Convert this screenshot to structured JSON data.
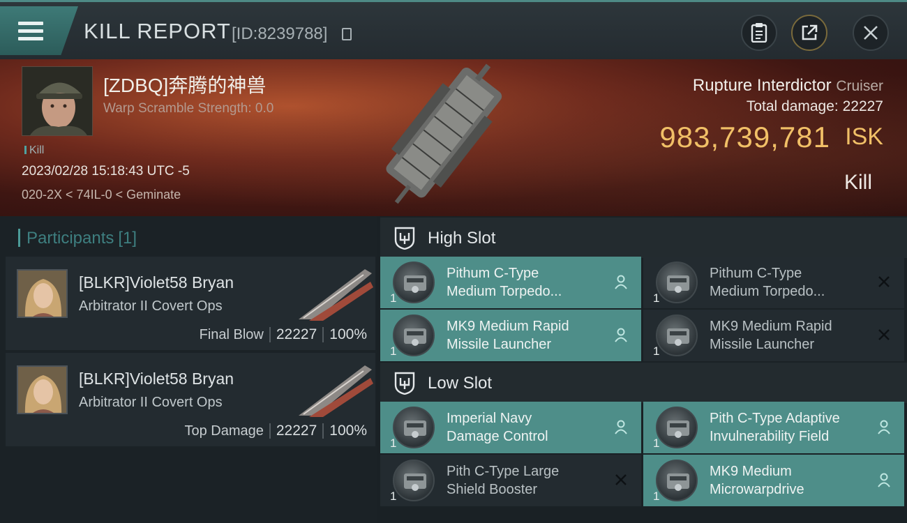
{
  "header": {
    "title": "KILL REPORT",
    "report_id": "[ID:8239788]",
    "icons": [
      "menu-icon",
      "copy-icon",
      "clipboard-icon",
      "share-icon",
      "close-icon"
    ]
  },
  "victim": {
    "name": "[ZDBQ]奔腾的神兽",
    "subtitle": "Warp Scramble Strength: 0.0",
    "tag": "Kill",
    "datetime": "2023/02/28 15:18:43 UTC -5",
    "location": "020-2X < 74IL-0 < Geminate"
  },
  "summary": {
    "ship": "Rupture Interdictor",
    "ship_class": "Cruiser",
    "damage_label": "Total damage:",
    "damage_value": "22227",
    "isk_value": "983,739,781",
    "isk_unit": "ISK",
    "result": "Kill"
  },
  "participants": {
    "title": "Participants",
    "count": "[1]",
    "cards": [
      {
        "name": "[BLKR]Violet58 Bryan",
        "ship": "Arbitrator II Covert Ops",
        "role": "Final Blow",
        "damage": "22227",
        "percent": "100%"
      },
      {
        "name": "[BLKR]Violet58 Bryan",
        "ship": "Arbitrator II Covert Ops",
        "role": "Top Damage",
        "damage": "22227",
        "percent": "100%"
      }
    ]
  },
  "slots": {
    "high": {
      "label": "High Slot",
      "modules": [
        {
          "line1": "Pithum C-Type",
          "line2": "Medium Torpedo...",
          "qty": "1",
          "status": "dropped"
        },
        {
          "line1": "Pithum C-Type",
          "line2": "Medium Torpedo...",
          "qty": "1",
          "status": "destroyed"
        },
        {
          "line1": "MK9 Medium Rapid",
          "line2": "Missile Launcher",
          "qty": "1",
          "status": "dropped"
        },
        {
          "line1": "MK9 Medium Rapid",
          "line2": "Missile Launcher",
          "qty": "1",
          "status": "destroyed"
        }
      ]
    },
    "low": {
      "label": "Low Slot",
      "modules": [
        {
          "line1": "Imperial Navy",
          "line2": "Damage Control",
          "qty": "1",
          "status": "dropped"
        },
        {
          "line1": "Pith C-Type Adaptive",
          "line2": "Invulnerability Field",
          "qty": "1",
          "status": "dropped"
        },
        {
          "line1": "Pith C-Type Large",
          "line2": "Shield Booster",
          "qty": "1",
          "status": "destroyed"
        },
        {
          "line1": "MK9 Medium",
          "line2": "Microwarpdrive",
          "qty": "1",
          "status": "dropped"
        }
      ]
    }
  },
  "colors": {
    "accent_teal": "#4e8e89",
    "isk_gold": "#f1c067"
  }
}
